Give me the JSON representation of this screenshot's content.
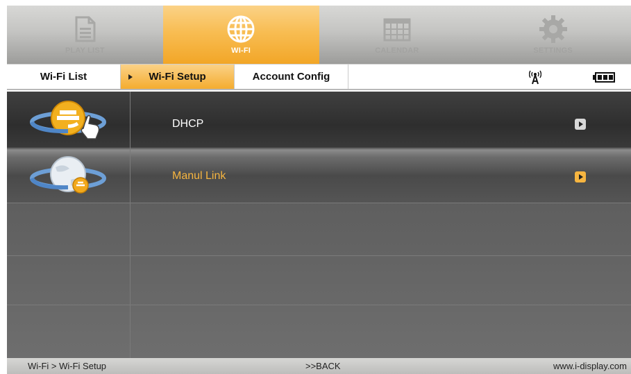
{
  "top_tabs": [
    {
      "label": "PLAY LIST",
      "icon": "playlist-icon"
    },
    {
      "label": "WI-FI",
      "icon": "globe-icon",
      "active": true
    },
    {
      "label": "CALENDAR",
      "icon": "calendar-icon"
    },
    {
      "label": "SETTINGS",
      "icon": "gear-icon"
    }
  ],
  "sub_tabs": [
    {
      "label": "Wi-Fi List"
    },
    {
      "label": "Wi-Fi Setup",
      "active": true
    },
    {
      "label": "Account Config"
    }
  ],
  "status_icons": [
    "wifi-signal-icon",
    "battery-icon"
  ],
  "list_items": [
    {
      "label": "DHCP",
      "icon": "ie-globe-hand-icon",
      "selected": false
    },
    {
      "label": "Manul Link",
      "icon": "globe-link-icon",
      "selected": true
    }
  ],
  "footer": {
    "breadcrumb": "Wi-Fi > Wi-Fi Setup",
    "back": ">>BACK",
    "website": "www.i-display.com"
  },
  "colors": {
    "accent": "#f6b540",
    "content_bg": "#5a5a5a",
    "topbar_bg": "#c4c4c2"
  }
}
